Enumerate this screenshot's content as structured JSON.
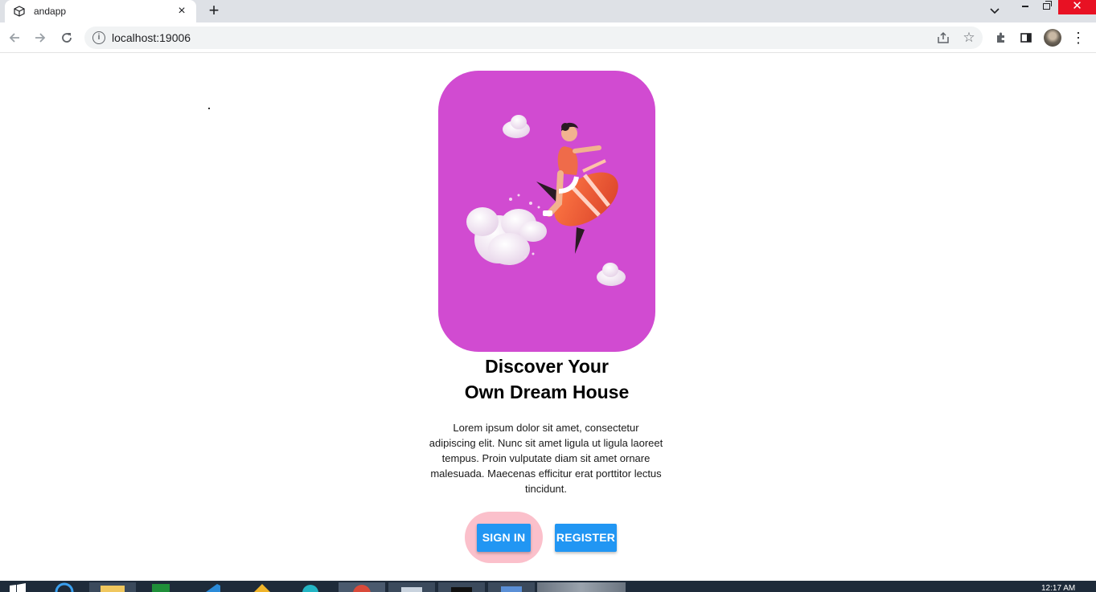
{
  "browser": {
    "tab_title": "andapp",
    "tab_close": "×",
    "new_tab": "+",
    "url": "localhost:19006",
    "close_glyph": "✕",
    "star_glyph": "☆",
    "menu_glyph": "⋮",
    "info_glyph": "i"
  },
  "page": {
    "title_line1": "Discover Your",
    "title_line2": "Own Dream House",
    "body": "Lorem ipsum dolor sit amet, consectetur adipiscing elit. Nunc sit amet ligula ut ligula laoreet tempus. Proin vulputate diam sit amet ornare malesuada. Maecenas efficitur erat porttitor lectus tincidunt.",
    "signin_label": "SIGN IN",
    "register_label": "REGISTER"
  },
  "taskbar": {
    "time": "12:17 AM"
  },
  "colors": {
    "card_bg": "#d14bd1",
    "button_bg": "#2196f3",
    "signin_halo": "#fbc0cb"
  },
  "icons": [
    "tab-favicon-icon",
    "close-icon",
    "plus-icon",
    "chevron-down-icon",
    "back-arrow-icon",
    "forward-arrow-icon",
    "reload-icon",
    "info-icon",
    "share-icon",
    "star-icon",
    "extensions-icon",
    "side-panel-icon",
    "kebab-menu-icon"
  ]
}
